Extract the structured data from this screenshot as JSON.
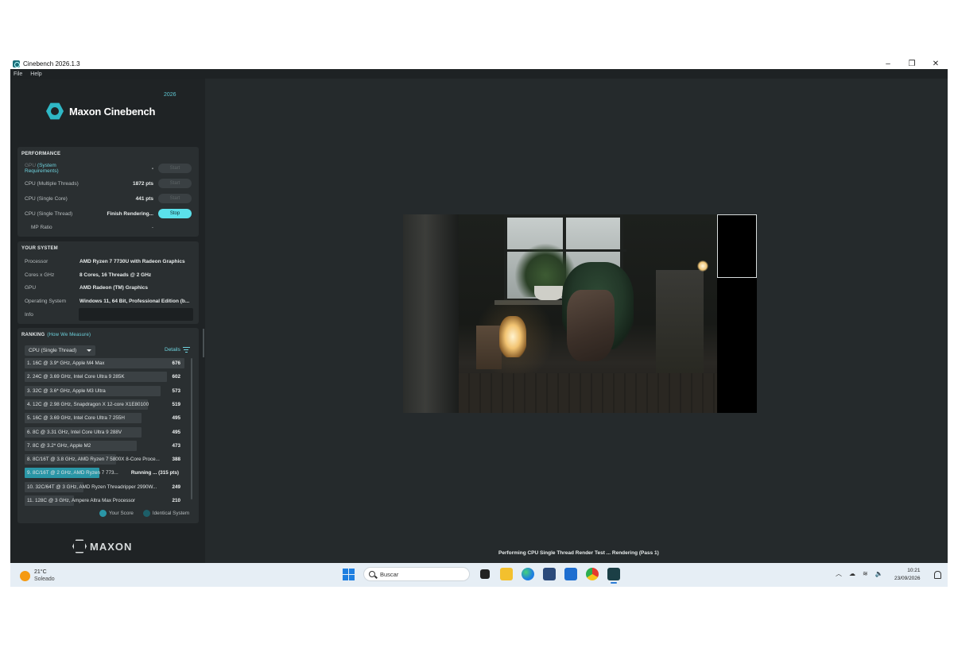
{
  "window": {
    "title": "Cinebench 2026.1.3",
    "controls": [
      "–",
      "❐",
      "✕"
    ]
  },
  "menu": [
    "File",
    "Help"
  ],
  "logo": {
    "name": "Maxon Cinebench",
    "year": "2026"
  },
  "performance": {
    "title": "PERFORMANCE",
    "rows": [
      {
        "label_prefix": "GPU",
        "label_link": "(System Requirements)",
        "value": "-",
        "button": "Start",
        "active": false
      },
      {
        "label": "CPU (Multiple Threads)",
        "value": "1872 pts",
        "button": "Start",
        "active": false
      },
      {
        "label": "CPU (Single Core)",
        "value": "441 pts",
        "button": "Start",
        "active": false
      },
      {
        "label": "CPU (Single Thread)",
        "value": "Finish Rendering...",
        "button": "Stop",
        "active": true
      },
      {
        "label": "MP Ratio",
        "value": "-"
      }
    ]
  },
  "system": {
    "title": "YOUR SYSTEM",
    "rows": [
      {
        "label": "Processor",
        "value": "AMD Ryzen 7 7730U with Radeon Graphics"
      },
      {
        "label": "Cores x GHz",
        "value": "8 Cores, 16 Threads @ 2 GHz"
      },
      {
        "label": "GPU",
        "value": "AMD Radeon (TM) Graphics"
      },
      {
        "label": "Operating System",
        "value": "Windows 11, 64 Bit, Professional Edition (b..."
      },
      {
        "label": "Info",
        "value": ""
      }
    ]
  },
  "ranking": {
    "title": "RANKING",
    "link": "(How We Measure)",
    "select": "CPU (Single Thread)",
    "details": "Details",
    "rows": [
      {
        "label": "1. 16C @ 3.9* GHz, Apple M4 Max",
        "score": "676",
        "fraction": 1.0
      },
      {
        "label": "2. 24C @ 3.69 GHz, Intel Core Ultra 9 285K",
        "score": "602",
        "fraction": 0.89
      },
      {
        "label": "3. 32C @ 3.6* GHz, Apple M3 Ultra",
        "score": "573",
        "fraction": 0.85
      },
      {
        "label": "4. 12C @ 2.98 GHz, Snapdragon X 12-core X1E80100",
        "score": "519",
        "fraction": 0.77
      },
      {
        "label": "5. 16C @ 3.69 GHz, Intel Core Ultra 7 255H",
        "score": "495",
        "fraction": 0.73
      },
      {
        "label": "6. 8C @ 3.31 GHz, Intel Core Ultra 9 288V",
        "score": "495",
        "fraction": 0.73
      },
      {
        "label": "7. 8C @ 3.2* GHz, Apple M2",
        "score": "473",
        "fraction": 0.7
      },
      {
        "label": "8. 8C/16T @ 3.8 GHz, AMD Ryzen 7 5800X 8-Core Proce...",
        "score": "388",
        "fraction": 0.57
      },
      {
        "label": "9. 8C/16T @ 2 GHz, AMD Ryzen 7 773...",
        "score": "Running ... (315 pts)",
        "fraction": 0.47,
        "mine": true
      },
      {
        "label": "10. 32C/64T @ 3 GHz, AMD Ryzen Threadripper 2990W...",
        "score": "249",
        "fraction": 0.37
      },
      {
        "label": "11. 128C @ 3 GHz, Ampere Altra Max Processor",
        "score": "210",
        "fraction": 0.31
      }
    ],
    "legend": [
      {
        "label": "Your Score",
        "color": "#2a96a6"
      },
      {
        "label": "Identical System",
        "color": "#1d5e68"
      }
    ]
  },
  "brand": "MAXON",
  "status": "Performing CPU Single Thread Render Test ... Rendering (Pass 1)",
  "taskbar": {
    "weather_temp": "21°C",
    "weather_desc": "Soleado",
    "search_placeholder": "Buscar",
    "time": "10:21",
    "date": "23/09/2026",
    "tray_icons": [
      "chevron-up-icon",
      "onedrive-icon",
      "wifi-icon",
      "volume-icon"
    ],
    "apps": [
      "file-explorer-black-icon",
      "folder-icon",
      "edge-icon",
      "store-icon",
      "outlook-icon",
      "chrome-icon",
      "cinebench-icon"
    ]
  }
}
